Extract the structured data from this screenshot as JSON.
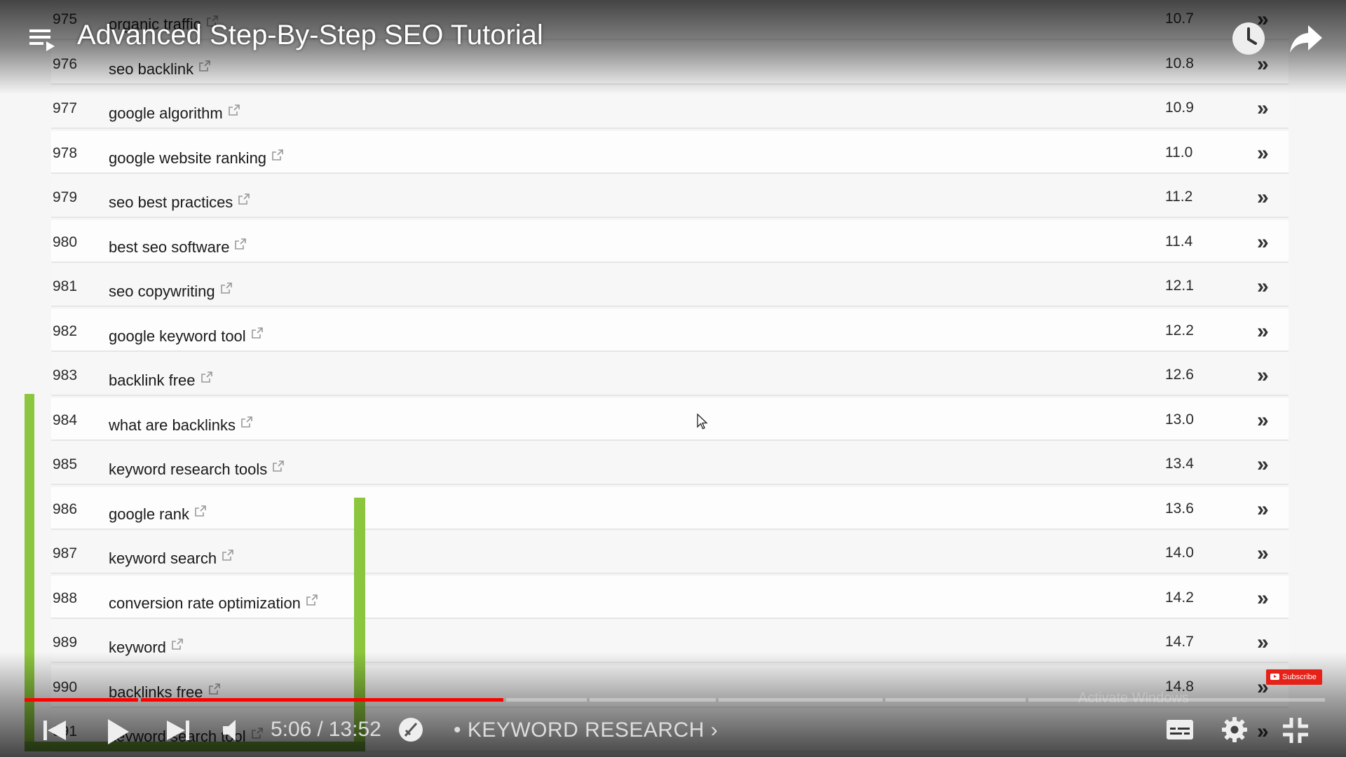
{
  "player": {
    "title": "Advanced Step-By-Step SEO Tutorial",
    "time_current": "5:06",
    "time_separator": "/",
    "time_total": "13:52",
    "chapter": "• KEYWORD RESEARCH",
    "chapter_arrow": "›",
    "subscribe_label": "Subscribe",
    "watermark": "Activate Windows",
    "progress_fraction": 0.368,
    "accent_color": "#ff0000",
    "highlight_color": "#8cc63f"
  },
  "table": {
    "rows": [
      {
        "rank": "975",
        "keyword": "organic traffic",
        "value": "10.7"
      },
      {
        "rank": "976",
        "keyword": "seo backlink",
        "value": "10.8"
      },
      {
        "rank": "977",
        "keyword": "google algorithm",
        "value": "10.9"
      },
      {
        "rank": "978",
        "keyword": "google website ranking",
        "value": "11.0"
      },
      {
        "rank": "979",
        "keyword": "seo best practices",
        "value": "11.2"
      },
      {
        "rank": "980",
        "keyword": "best seo software",
        "value": "11.4"
      },
      {
        "rank": "981",
        "keyword": "seo copywriting",
        "value": "12.1"
      },
      {
        "rank": "982",
        "keyword": "google keyword tool",
        "value": "12.2"
      },
      {
        "rank": "983",
        "keyword": "backlink free",
        "value": "12.6"
      },
      {
        "rank": "984",
        "keyword": "what are backlinks",
        "value": "13.0"
      },
      {
        "rank": "985",
        "keyword": "keyword research tools",
        "value": "13.4"
      },
      {
        "rank": "986",
        "keyword": "google rank",
        "value": "13.6"
      },
      {
        "rank": "987",
        "keyword": "keyword search",
        "value": "14.0"
      },
      {
        "rank": "988",
        "keyword": "conversion rate optimization",
        "value": "14.2"
      },
      {
        "rank": "989",
        "keyword": "keyword",
        "value": "14.7"
      },
      {
        "rank": "990",
        "keyword": "backlinks free",
        "value": "14.8"
      },
      {
        "rank": "991",
        "keyword": "keyword search tool",
        "value": ""
      }
    ]
  },
  "icons": {
    "playlist": "playlist-icon",
    "watch_later": "clock-icon",
    "share": "share-arrow-icon",
    "prev": "skip-previous-icon",
    "play": "play-icon",
    "next": "skip-next-icon",
    "volume": "volume-icon",
    "chapter": "chapter-icon",
    "subtitles": "subtitles-icon",
    "settings": "gear-icon",
    "fullscreen": "exit-fullscreen-icon",
    "row_action": "double-chevron-right-icon",
    "external_link": "external-link-icon"
  }
}
